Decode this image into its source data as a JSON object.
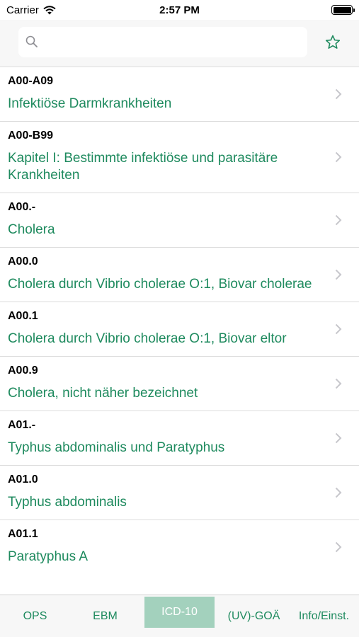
{
  "status_bar": {
    "carrier": "Carrier",
    "time": "2:57 PM"
  },
  "search": {
    "value": "",
    "placeholder": ""
  },
  "colors": {
    "accent": "#1e8a5e",
    "active_tab_bg": "#a3d1bd",
    "separator": "#dcdcdc"
  },
  "list": {
    "items": [
      {
        "code": "A00-A09",
        "title": "Infektiöse Darmkrankheiten"
      },
      {
        "code": "A00-B99",
        "title": "Kapitel I: Bestimmte infektiöse und parasitäre Krankheiten"
      },
      {
        "code": "A00.-",
        "title": "Cholera"
      },
      {
        "code": "A00.0",
        "title": "Cholera durch Vibrio cholerae O:1, Biovar cholerae"
      },
      {
        "code": "A00.1",
        "title": "Cholera durch Vibrio cholerae O:1, Biovar eltor"
      },
      {
        "code": "A00.9",
        "title": "Cholera, nicht näher bezeichnet"
      },
      {
        "code": "A01.-",
        "title": "Typhus abdominalis und Paratyphus"
      },
      {
        "code": "A01.0",
        "title": "Typhus abdominalis"
      },
      {
        "code": "A01.1",
        "title": "Paratyphus A"
      }
    ]
  },
  "tabs": [
    {
      "label": "OPS",
      "active": false
    },
    {
      "label": "EBM",
      "active": false
    },
    {
      "label": "ICD-10",
      "active": true
    },
    {
      "label": "(UV)-GOÄ",
      "active": false
    },
    {
      "label": "Info/Einst.",
      "active": false
    }
  ]
}
